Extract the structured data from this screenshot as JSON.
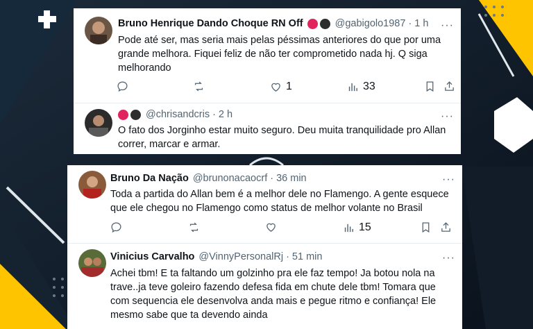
{
  "colors": {
    "accent_yellow": "#ffc400",
    "link_gray": "#536471",
    "text": "#0f1419"
  },
  "top_card": {
    "tweet1": {
      "name": "Bruno Henrique Dando Choque RN Off",
      "handle": "@gabigolo1987",
      "time": "1 h",
      "text": "Pode até ser, mas seria mais pelas péssimas anteriores do que por uma grande melhora. Fiquei feliz de não ter comprometido nada hj. Q siga melhorando",
      "likes": "1",
      "views": "33",
      "more": "···"
    },
    "tweet2": {
      "handle": "@chrisandcris",
      "time": "2 h",
      "text": "O fato dos Jorginho estar muito seguro. Deu muita tranquilidade pro Allan correr, marcar e armar.",
      "more": "···"
    }
  },
  "bottom_card": {
    "tweet1": {
      "name": "Bruno Da Nação",
      "handle": "@brunonacaocrf",
      "time": "36 min",
      "text": "Toda a partida do Allan bem é a melhor dele no Flamengo. A gente esquece que ele chegou no Flamengo como status de melhor volante no Brasil",
      "views": "15",
      "more": "···"
    },
    "tweet2": {
      "name": "Vinicius Carvalho",
      "handle": "@VinnyPersonalRj",
      "time": "51 min",
      "text": "Achei tbm! E ta faltando um golzinho pra ele faz tempo! Ja botou nola na trave..ja teve goleiro fazendo defesa fida em chute dele tbm! Tomara que com sequencia ele desenvolva anda mais e pegue ritmo e confiança! Ele mesmo sabe que ta devendo ainda",
      "more": "···"
    }
  },
  "separator": "·"
}
